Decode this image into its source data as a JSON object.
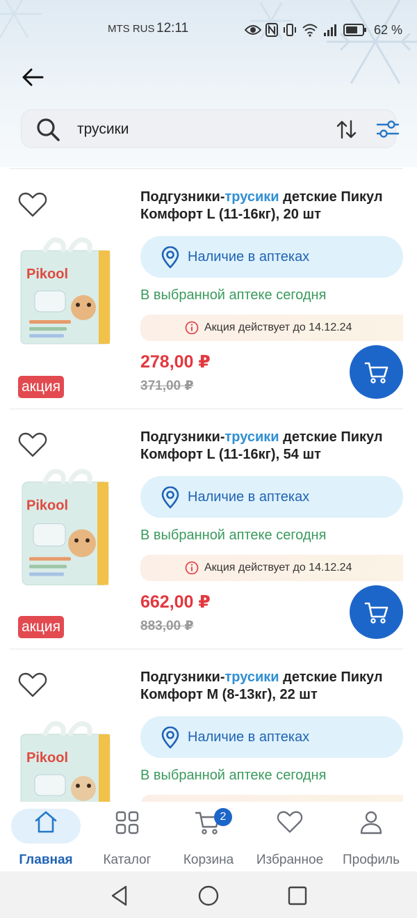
{
  "status_bar": {
    "carrier": "MTS RUS",
    "time": "12:11",
    "battery": "62 %"
  },
  "search": {
    "query": "трусики"
  },
  "products": [
    {
      "title_before": "Подгузники-",
      "title_highlight": "трусики",
      "title_after": " детские Пикул Комфорт L (11-16кг), 20 шт",
      "availability_label": "Наличие в аптеках",
      "delivery_note": "В выбранной аптеке сегодня",
      "promo_text": "Акция действует до 14.12.24",
      "price": "278,00 ₽",
      "old_price": "371,00 ₽",
      "badge": "акция",
      "brand": "Pikool"
    },
    {
      "title_before": "Подгузники-",
      "title_highlight": "трусики",
      "title_after": " детские Пикул Комфорт L (11-16кг), 54 шт",
      "availability_label": "Наличие в аптеках",
      "delivery_note": "В выбранной аптеке сегодня",
      "promo_text": "Акция действует до 14.12.24",
      "price": "662,00 ₽",
      "old_price": "883,00 ₽",
      "badge": "акция",
      "brand": "Pikool"
    },
    {
      "title_before": "Подгузники-",
      "title_highlight": "трусики",
      "title_after": " детские Пикул Комфорт M (8-13кг), 22 шт",
      "availability_label": "Наличие в аптеках",
      "delivery_note": "В выбранной аптеке сегодня",
      "brand": "Pikool"
    }
  ],
  "bottom_nav": {
    "items": [
      {
        "label": "Главная",
        "icon": "home-icon"
      },
      {
        "label": "Каталог",
        "icon": "grid-icon"
      },
      {
        "label": "Корзина",
        "icon": "cart-icon"
      },
      {
        "label": "Избранное",
        "icon": "heart-icon"
      },
      {
        "label": "Профиль",
        "icon": "user-icon"
      }
    ],
    "cart_count": "2",
    "active": "Главная"
  },
  "colors": {
    "accent_blue": "#1d66c9",
    "highlight_blue": "#2f8fd3",
    "price_red": "#e2383f",
    "badge_red": "#e24a50",
    "availability_green": "#3a9a5d"
  }
}
